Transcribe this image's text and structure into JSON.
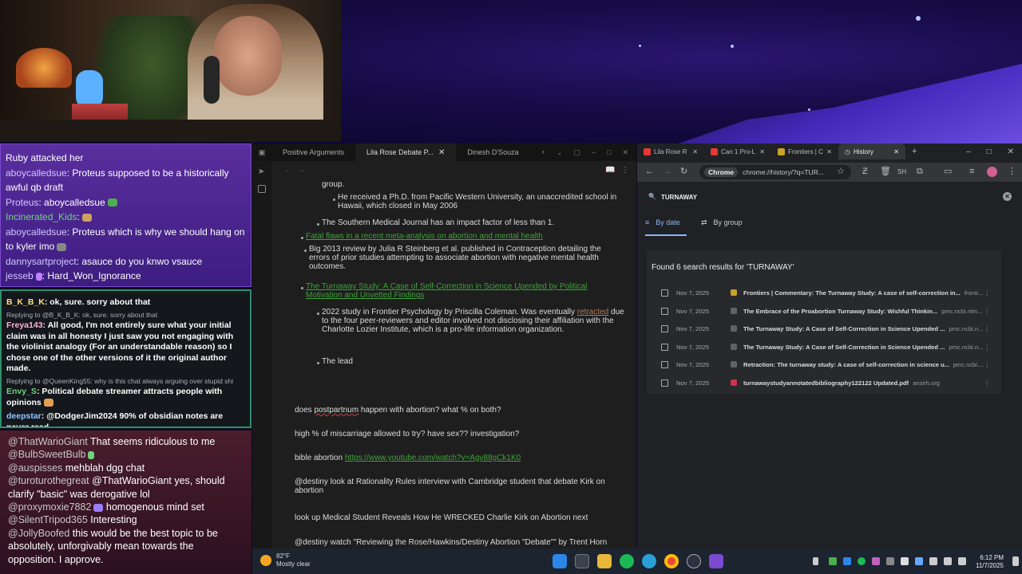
{
  "chat_top": {
    "messages": [
      {
        "user": "",
        "text": "Ruby attacked her"
      },
      {
        "user": "aboycalledsue",
        "text": ": Proteus supposed to be a historically awful qb draft"
      },
      {
        "user": "Proteus",
        "text": ": aboycalledsue"
      },
      {
        "user": "Incinerated_Kids",
        "text": ":"
      },
      {
        "user": "aboycalledsue",
        "text": ": Proteus which is why we should hang on to kyler imo"
      },
      {
        "user": "dannysartproject",
        "text": ": asauce do you knwo vsauce"
      },
      {
        "user": "jesseb",
        "text": ": Hard_Won_Ignorance"
      }
    ]
  },
  "chat_mid": {
    "messages": [
      {
        "reply": "",
        "user": "B_K_B_K",
        "text": ": ok, sure. sorry about that"
      },
      {
        "reply": "Replying to @B_K_B_K: ok, sure. sorry about that",
        "user": "Freya143",
        "text": ": All good, I'm not entirely sure what your initial claim was in all honesty I just saw you not engaging with the violinist analogy (For an understandable reason) so I chose one of the other versions of it the original author made."
      },
      {
        "reply": "Replying to @QueenKing55: why is this chat always arguing over stupid shi",
        "user": "Envy_S",
        "text": ": Political debate streamer attracts people with opinions"
      },
      {
        "reply": "",
        "user": "deepstar",
        "text": ": @DodgerJim2024 90% of obsidian notes are never read"
      }
    ]
  },
  "chat_bottom": {
    "messages": [
      {
        "user": "@ThatWarioGiant",
        "text": " That seems ridiculous to me"
      },
      {
        "user": "@BulbSweetBulb",
        "text": ""
      },
      {
        "user": "@auspisses",
        "text": " mehblah dgg chat"
      },
      {
        "user": "@turoturothegreat",
        "text": " @ThatWarioGiant yes, should clarify \"basic\" was derogative lol"
      },
      {
        "user": "@proxymoxie7882",
        "text": " homogenous mind set"
      },
      {
        "user": "@SilentTripod365",
        "text": " Interesting"
      },
      {
        "user": "@JollyBoofed",
        "text": " this would be the best topic to be absolutely, unforgivably mean towards the opposition. I approve."
      }
    ]
  },
  "notes": {
    "tabs": [
      {
        "label": "Positive Arguments"
      },
      {
        "label": "Lila Rose Debate P..."
      },
      {
        "label": "Dinesh D'Souza"
      }
    ],
    "lines": {
      "group": "group.",
      "phd": "He received a Ph.D. from Pacific Western University, an unaccredited school in Hawaii, which closed in May 2006",
      "impact": "The Southern Medical Journal has an impact factor of less than 1.",
      "fatal": "Fatal flaws in a recent meta-analysis on abortion and mental health",
      "big2013": "Big 2013 review by Julia R Steinberg et al. published in Contraception detailing the errors of prior studies attempting to associate abortion with negative mental health outcomes.",
      "turnaway_link": "The Turnaway Study: A Case of Self-Correction in Science Upended by Political Motivation and Unvetted Findings",
      "study2022_a": "2022 study in Frontier Psychology by Priscilla Coleman. Was eventually",
      "retracted": "retracted",
      "study2022_b": "due to the four peer-reviewers and editor involved not disclosing their affiliation with the Charlotte Lozier Institute, which is a pro-life information organization.",
      "lead": "The lead",
      "q1_a": "does",
      "q1_b": "postpartnum",
      "q1_c": "happen with abortion? what % on both?",
      "q2": "high % of miscarriage allowed to try? have sex?? investigation?",
      "q3": "bible abortion",
      "q3_link": "https://www.youtube.com/watch?v=Agy88gCk1K0",
      "q4": "@destiny look at Rationality Rules interview with Cambridge student that debate Kirk on abortion",
      "q5": "look up Medical Student Reveals How He WRECKED Charlie Kirk on Abortion next",
      "q6": "@destiny watch \"Reviewing the Rose/Hawkins/Destiny Abortion \"Debate\"\" by Trent Horn"
    }
  },
  "chrome": {
    "tabs": [
      {
        "label": "Lila Rose R",
        "color": "#e53935"
      },
      {
        "label": "Can 1 Pro-L",
        "color": "#e53935"
      },
      {
        "label": "Frontiers | C",
        "color": "#c9a227"
      },
      {
        "label": "History",
        "color": "#9aa0a6"
      }
    ],
    "omnibox_chip": "Chrome",
    "url": "chrome://history/?q=TUR...",
    "search_query": "TURNAWAY",
    "filters": {
      "by_date": "By date",
      "by_group": "By group"
    },
    "results_heading": "Found 6 search results for 'TURNAWAY'",
    "results": [
      {
        "date": "Nov 7, 2025",
        "title": "Frontiers | Commentary: The Turnaway Study: A case of self-correction in...",
        "site": "fronti...",
        "fav": "#c9a227"
      },
      {
        "date": "Nov 7, 2025",
        "title": "The Embrace of the Proabortion Turnaway Study: Wishful Thinkin...",
        "site": "pmc.ncbi.nlm...",
        "fav": "#5f6368"
      },
      {
        "date": "Nov 7, 2025",
        "title": "The Turnaway Study: A Case of Self-Correction in Science Upended ...",
        "site": "pmc.ncbi.n...",
        "fav": "#5f6368"
      },
      {
        "date": "Nov 7, 2025",
        "title": "The Turnaway Study: A Case of Self-Correction in Science Upended ...",
        "site": "pmc.ncbi.n...",
        "fav": "#5f6368"
      },
      {
        "date": "Nov 7, 2025",
        "title": "Retraction: The turnaway study: A case of self-correction in science u...",
        "site": "pmc.ncbi....",
        "fav": "#5f6368"
      },
      {
        "date": "Nov 7, 2025",
        "title": "turnawaystudyannotatedbibliography122122 Updated.pdf",
        "site": "ansirh.org",
        "fav": "#d03050"
      }
    ]
  },
  "taskbar": {
    "temp": "82°F",
    "weather": "Mostly clear",
    "time": "6:12 PM",
    "date": "11/7/2025"
  }
}
